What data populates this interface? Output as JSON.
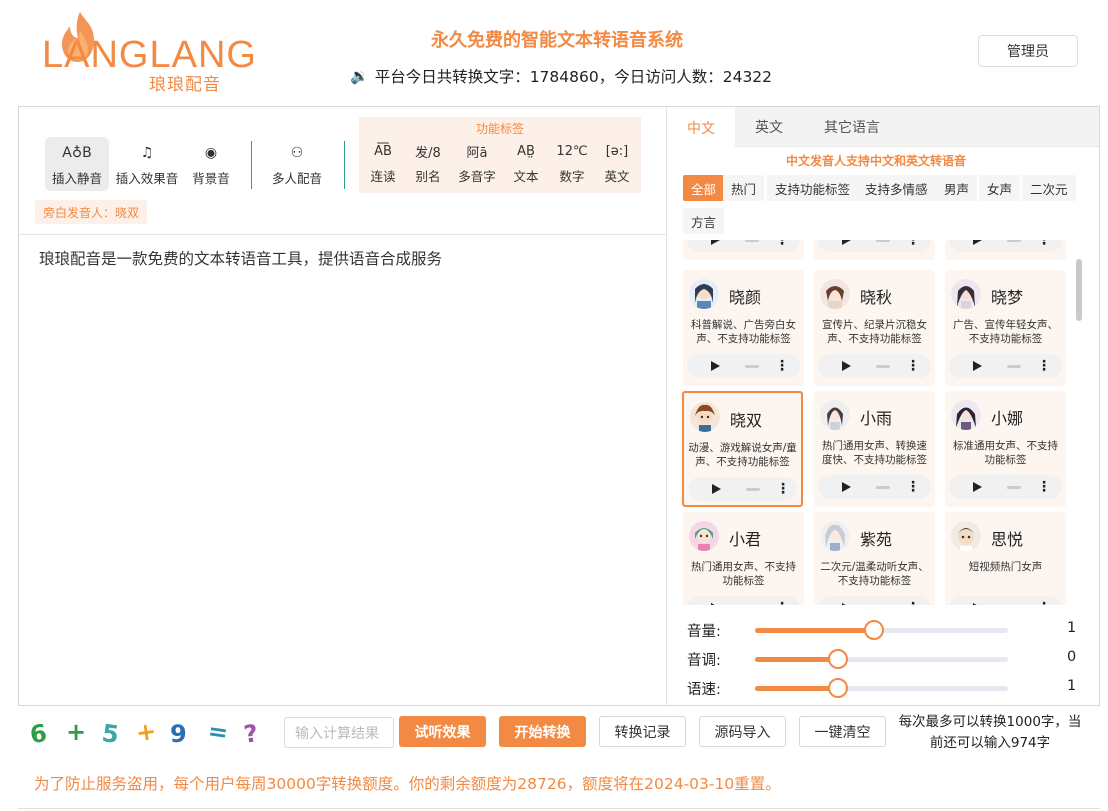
{
  "header": {
    "logo_text": "LANGLANG",
    "logo_sub": "琅琅配音",
    "site_title": "永久免费的智能文本转语音系统",
    "stats_icon": "speaker-book-icon",
    "stats_text": "平台今日共转换文字：1784860，今日访问人数：24322",
    "admin_label": "管理员"
  },
  "toolbar": {
    "tools": [
      {
        "label": "插入静音",
        "icon": "A♁B"
      },
      {
        "label": "插入效果音",
        "icon": "♫"
      },
      {
        "label": "背景音",
        "icon": "◉"
      },
      {
        "label": "多人配音",
        "icon": "⚇"
      }
    ],
    "func_title": "功能标签",
    "func_tools": [
      {
        "label": "连读",
        "icon": "A͞B"
      },
      {
        "label": "别名",
        "icon": "发/8"
      },
      {
        "label": "多音字",
        "icon": "阿ā"
      },
      {
        "label": "文本",
        "icon": "AB̤"
      },
      {
        "label": "数字",
        "icon": "12℃"
      },
      {
        "label": "英文",
        "icon": "[ə:]"
      }
    ],
    "narrator": "旁白发音人：晓双"
  },
  "editor": {
    "content": "琅琅配音是一款免费的文本转语音工具，提供语音合成服务"
  },
  "voice_panel": {
    "tabs": [
      "中文",
      "英文",
      "其它语言"
    ],
    "active_tab": "中文",
    "note": "中文发音人支持中文和英文转语音",
    "filters": [
      "全部",
      "热门",
      "支持功能标签",
      "支持多情感",
      "男声",
      "女声",
      "二次元",
      "方言"
    ],
    "active_filter": "全部",
    "voices": [
      {
        "name": "晓颜",
        "desc": "科普解说、广告旁白女声、不支持功能标签",
        "selected": false
      },
      {
        "name": "晓秋",
        "desc": "宣传片、纪录片沉稳女声、不支持功能标签",
        "selected": false
      },
      {
        "name": "晓梦",
        "desc": "广告、宣传年轻女声、不支持功能标签",
        "selected": false
      },
      {
        "name": "晓双",
        "desc": "动漫、游戏解说女声/童声、不支持功能标签",
        "selected": true
      },
      {
        "name": "小雨",
        "desc": "热门通用女声、转换速度快、不支持功能标签",
        "selected": false
      },
      {
        "name": "小娜",
        "desc": "标准通用女声、不支持功能标签",
        "selected": false
      },
      {
        "name": "小君",
        "desc": "热门通用女声、不支持功能标签",
        "selected": false
      },
      {
        "name": "紫苑",
        "desc": "二次元/温柔动听女声、不支持功能标签",
        "selected": false
      },
      {
        "name": "思悦",
        "desc": "短视频热门女声",
        "selected": false
      }
    ],
    "sliders": [
      {
        "label": "音量:",
        "value": "1",
        "level": 0.47
      },
      {
        "label": "音调:",
        "value": "0",
        "level": 0.33
      },
      {
        "label": "语速:",
        "value": "1",
        "level": 0.33
      }
    ]
  },
  "bottom": {
    "captcha_chars": [
      "6",
      "+",
      "5",
      "+",
      "9",
      "=",
      "?"
    ],
    "captcha_colors": [
      "#2e9c48",
      "#2e9c48",
      "#3aa7a6",
      "#f0a020",
      "#2a6fb5",
      "#2b8fb0",
      "#a050b0"
    ],
    "calc_placeholder": "输入计算结果",
    "buttons": {
      "preview": "试听效果",
      "convert": "开始转换",
      "history": "转换记录",
      "import": "源码导入",
      "clear": "一键清空"
    },
    "limit_note": "每次最多可以转换1000字，当前还可以输入974字",
    "quota_note": "为了防止服务盗用，每个用户每周30000字转换额度。你的剩余额度为28726，额度将在2024-03-10重置。"
  },
  "colors": {
    "accent": "#f28a44",
    "accent_light": "#fdf0e8",
    "divider": "#33a07a"
  }
}
